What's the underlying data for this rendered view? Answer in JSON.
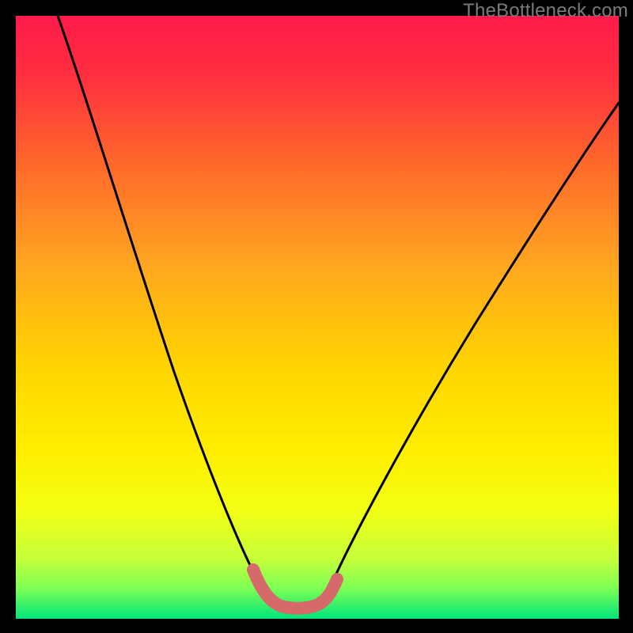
{
  "watermark": "TheBottleneck.com",
  "chart_data": {
    "type": "line",
    "title": "",
    "xlabel": "",
    "ylabel": "",
    "xlim": [
      0,
      100
    ],
    "ylim": [
      0,
      100
    ],
    "background_gradient": {
      "top": "#ff1a4a",
      "mid_upper": "#ffde00",
      "mid_lower": "#d8ff2e",
      "bottom": "#00e57a"
    },
    "series": [
      {
        "name": "bottleneck-curve",
        "color": "#000000",
        "x": [
          7,
          10,
          13,
          16,
          19,
          22,
          25,
          28,
          31,
          34,
          37,
          40,
          41,
          43,
          46,
          49,
          50,
          53,
          56,
          60,
          65,
          70,
          75,
          80,
          85,
          90,
          95,
          100
        ],
        "y": [
          100,
          90,
          80,
          71,
          63,
          55,
          47,
          40,
          33,
          26,
          19,
          12,
          9,
          6,
          3,
          2,
          2,
          3,
          7,
          12,
          19,
          26,
          33,
          40,
          48,
          55,
          62,
          69
        ]
      },
      {
        "name": "optimal-segment",
        "color": "#d66a6a",
        "x": [
          40,
          41,
          43,
          46,
          49,
          51,
          53
        ],
        "y": [
          10,
          7,
          4.5,
          3,
          3,
          4,
          6
        ]
      }
    ],
    "note": "Values are approximate percentages read from the unlabeled axes; curve minimum ~2% at x≈47."
  }
}
